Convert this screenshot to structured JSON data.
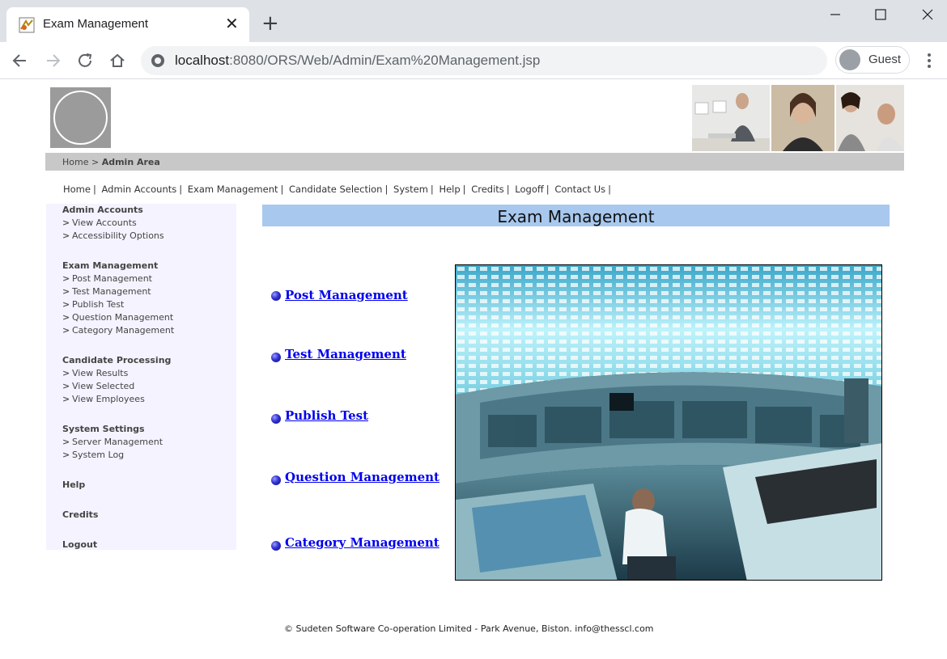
{
  "browser": {
    "tab_title": "Exam Management",
    "url_host": "localhost",
    "url_rest": ":8080/ORS/Web/Admin/Exam%20Management.jsp",
    "profile_label": "Guest"
  },
  "breadcrumb": {
    "home": "Home >",
    "current": "Admin Area"
  },
  "topnav": [
    "Home",
    "Admin Accounts",
    "Exam Management",
    "Candidate Selection",
    "System",
    "Help",
    "Credits",
    "Logoff",
    "Contact Us"
  ],
  "sidebar": {
    "admin_accounts": {
      "heading": "Admin Accounts",
      "items": [
        "View Accounts",
        "Accessibility Options"
      ]
    },
    "exam_management": {
      "heading": "Exam Management",
      "items": [
        "Post Management",
        "Test Management",
        "Publish Test",
        "Question Management",
        "Category Management"
      ]
    },
    "candidate_processing": {
      "heading": "Candidate Processing",
      "items": [
        "View Results",
        "View Selected",
        "View Employees"
      ]
    },
    "system_settings": {
      "heading": "System Settings",
      "items": [
        "Server Management",
        "System Log"
      ]
    },
    "help": "Help",
    "credits": "Credits",
    "logout": "Logout"
  },
  "content": {
    "title": "Exam Management",
    "links": [
      "Post Management",
      "Test Management",
      "Publish Test",
      "Question Management",
      "Category Management"
    ]
  },
  "footer": "© Sudeten Software Co-operation Limited - Park Avenue, Biston. info@thesscl.com",
  "colors": {
    "title_bar": "#a8c8ee",
    "sidebar_bg": "#f5f3ff",
    "crumb_bar": "#c8c8c8",
    "link": "#0000ee"
  }
}
